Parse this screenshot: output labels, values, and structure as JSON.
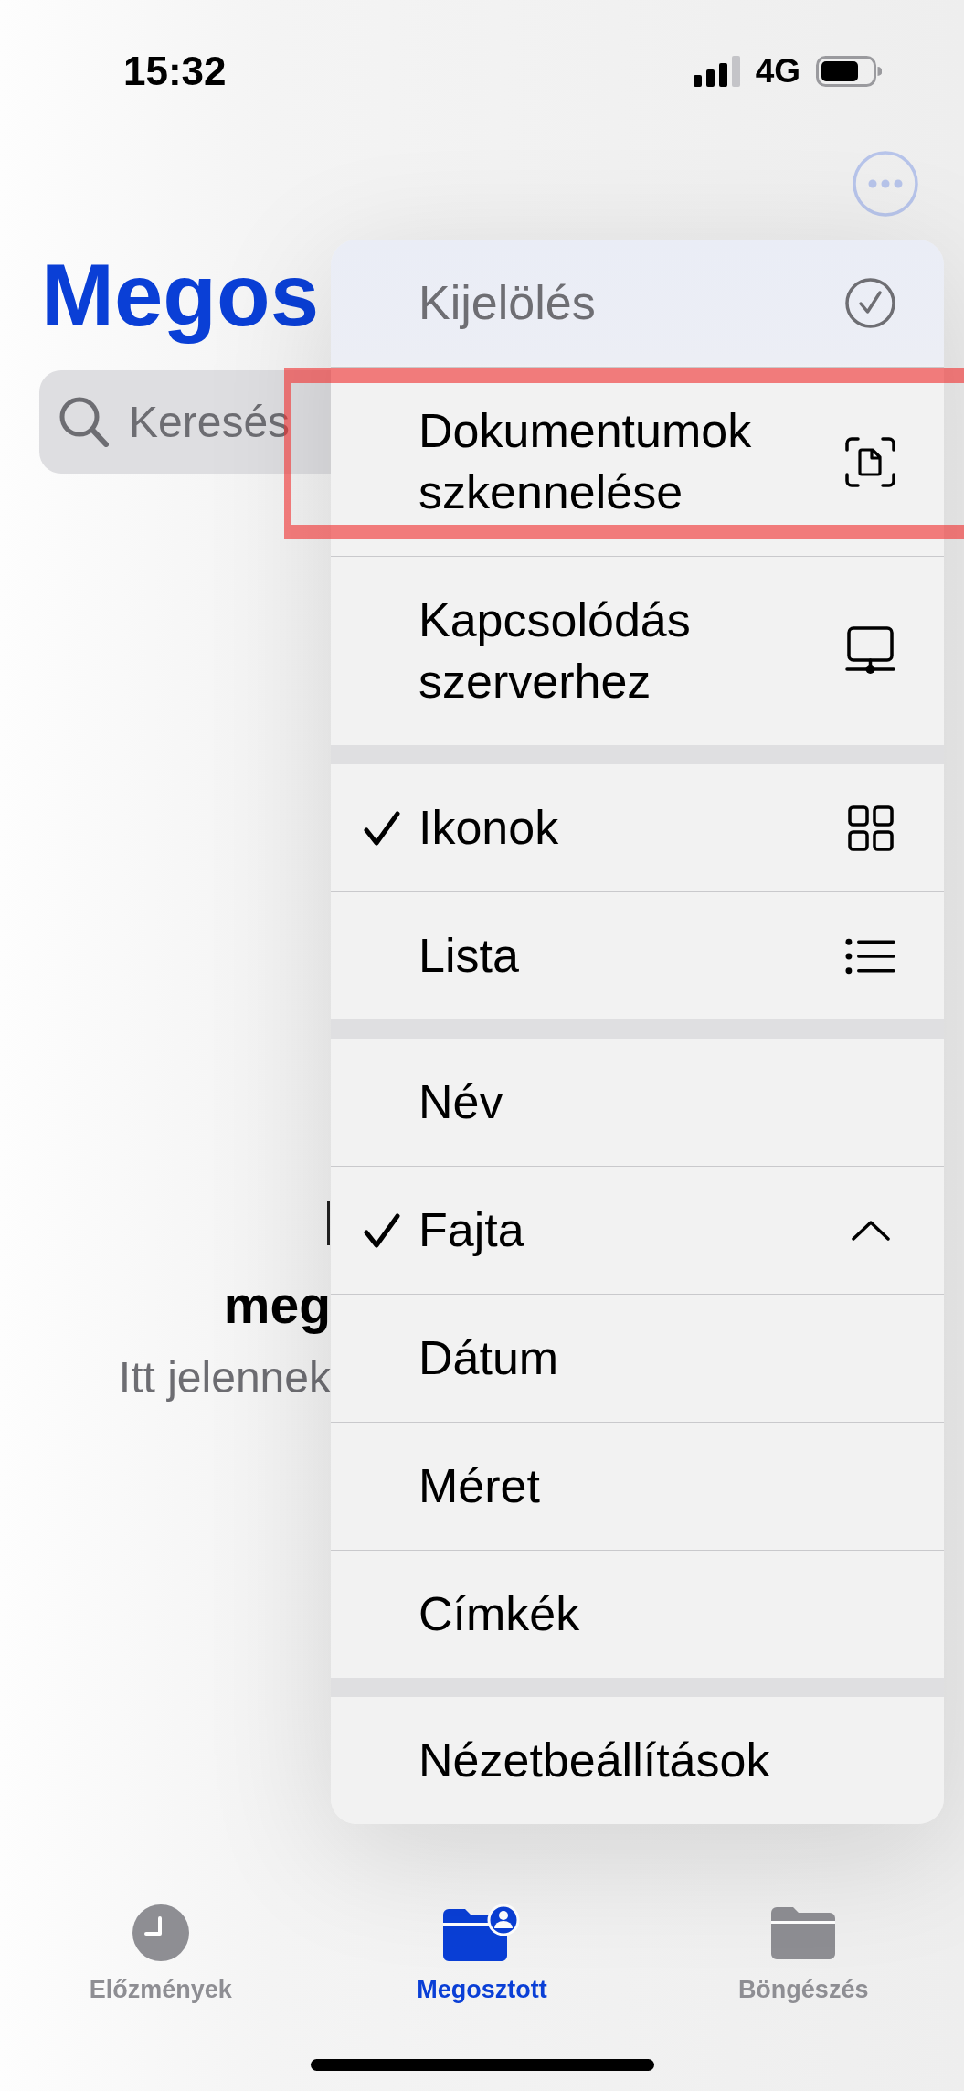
{
  "status_bar": {
    "time": "15:32",
    "network": "4G"
  },
  "header": {
    "title": "Megos"
  },
  "search": {
    "placeholder": "Keresés"
  },
  "empty_state": {
    "title": "meg",
    "message": "Itt jelennek"
  },
  "menu": {
    "sections": [
      {
        "kind": "actions",
        "items": [
          {
            "label": "Kijelölés",
            "disabled": true,
            "highlighted": false
          },
          {
            "label": "Dokumentumok szkennelése",
            "disabled": false,
            "highlighted": true
          },
          {
            "label": "Kapcsolódás szerverhez",
            "disabled": false,
            "highlighted": false
          }
        ]
      },
      {
        "kind": "view",
        "items": [
          {
            "label": "Ikonok",
            "checked": true
          },
          {
            "label": "Lista",
            "checked": false
          }
        ]
      },
      {
        "kind": "sort",
        "ascending": true,
        "items": [
          {
            "label": "Név",
            "checked": false
          },
          {
            "label": "Fajta",
            "checked": true
          },
          {
            "label": "Dátum",
            "checked": false
          },
          {
            "label": "Méret",
            "checked": false
          },
          {
            "label": "Címkék",
            "checked": false
          }
        ]
      },
      {
        "kind": "options",
        "items": [
          {
            "label": "Nézetbeállítások"
          }
        ]
      }
    ]
  },
  "tab_bar": {
    "tabs": [
      {
        "label": "Előzmények",
        "selected": false
      },
      {
        "label": "Megosztott",
        "selected": true
      },
      {
        "label": "Böngészés",
        "selected": false
      }
    ]
  }
}
